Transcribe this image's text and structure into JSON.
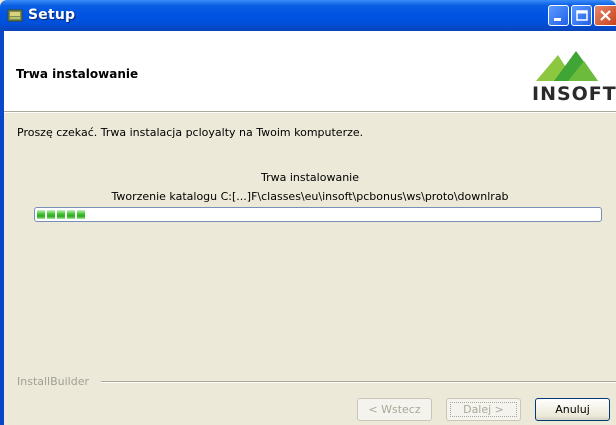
{
  "window": {
    "title": "Setup",
    "icon": "setup-icon",
    "controls": [
      "minimize-icon",
      "maximize-icon",
      "close-icon"
    ]
  },
  "header": {
    "title": "Trwa instalowanie",
    "logo_text": "INSOFT"
  },
  "body": {
    "description": "Proszę czekać. Trwa instalacja pcloyalty na Twoim komputerze.",
    "status_title": "Trwa instalowanie",
    "status_detail": "Tworzenie katalogu C:[...]F\\classes\\eu\\insoft\\pcbonus\\ws\\proto\\downlrab",
    "progress_fraction": 0.09
  },
  "footer": {
    "brand": "InstallBuilder",
    "back_label": "< Wstecz",
    "next_label": "Dalej >",
    "cancel_label": "Anuluj"
  },
  "colors": {
    "titlebar": "#0054e3",
    "progress": "#3ec22f",
    "dialog_bg": "#ece9d8"
  }
}
